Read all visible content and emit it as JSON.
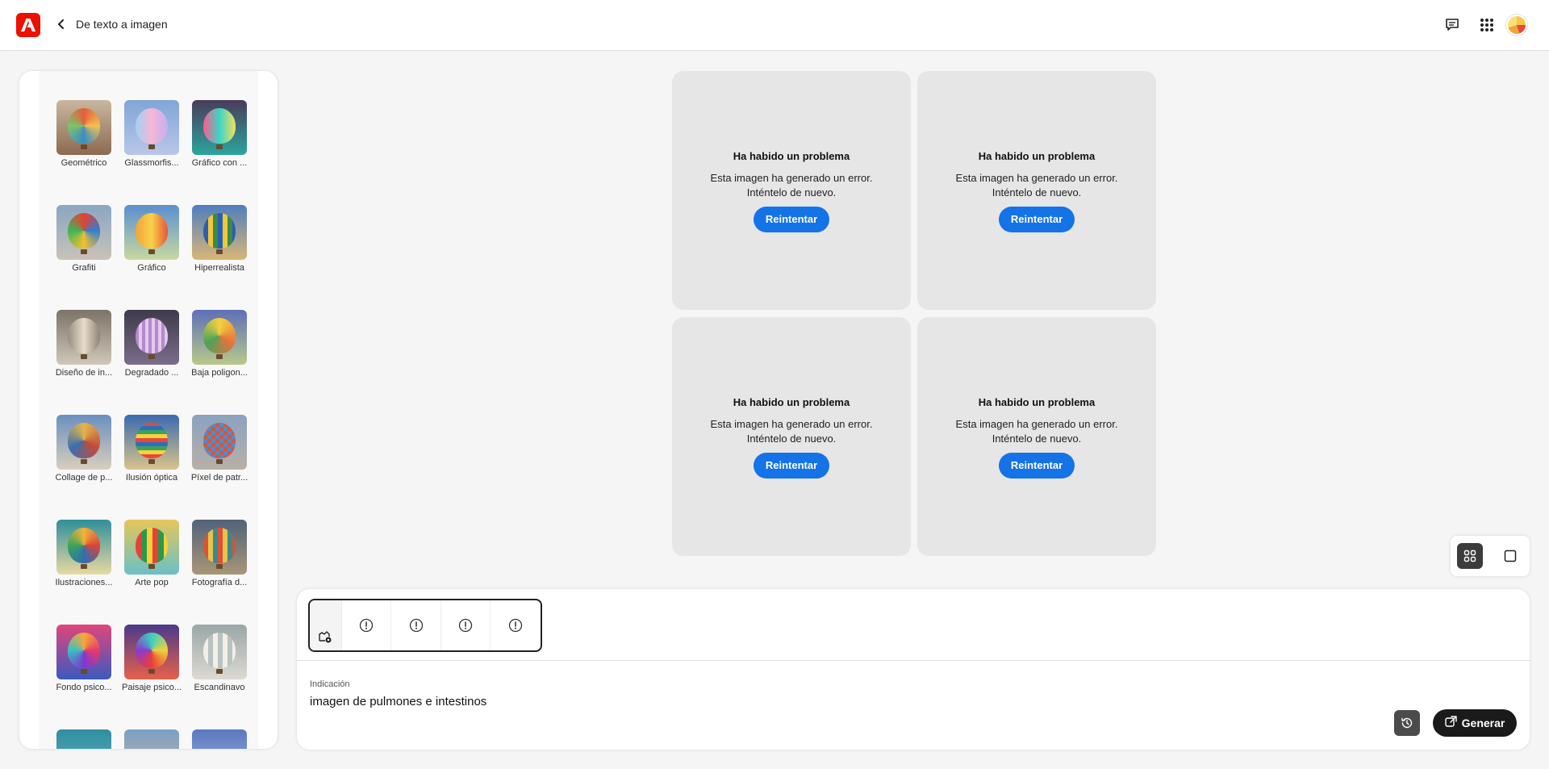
{
  "header": {
    "title": "De texto a imagen",
    "icons": [
      "adobe-logo",
      "chevron-left-icon",
      "comment-icon",
      "apps-grid-icon",
      "avatar"
    ]
  },
  "sidebar": {
    "styles": [
      {
        "label": "Geométrico"
      },
      {
        "label": "Glassmorfis..."
      },
      {
        "label": "Gráfico con ..."
      },
      {
        "label": "Grafiti"
      },
      {
        "label": "Gráfico"
      },
      {
        "label": "Hiperrealista"
      },
      {
        "label": "Diseño de in..."
      },
      {
        "label": "Degradado ..."
      },
      {
        "label": "Baja poligon..."
      },
      {
        "label": "Collage de p..."
      },
      {
        "label": "Ilusión óptica"
      },
      {
        "label": "Píxel de patr..."
      },
      {
        "label": "Ilustraciones..."
      },
      {
        "label": "Arte pop"
      },
      {
        "label": "Fotografía d..."
      },
      {
        "label": "Fondo psico..."
      },
      {
        "label": "Paisaje psico..."
      },
      {
        "label": "Escandinavo"
      },
      {
        "label": ""
      },
      {
        "label": ""
      },
      {
        "label": ""
      }
    ]
  },
  "results": {
    "cards": [
      {
        "title": "Ha habido un problema",
        "line1": "Esta imagen ha generado un error.",
        "line2": "Inténtelo de nuevo.",
        "button": "Reintentar"
      },
      {
        "title": "Ha habido un problema",
        "line1": "Esta imagen ha generado un error.",
        "line2": "Inténtelo de nuevo.",
        "button": "Reintentar"
      },
      {
        "title": "Ha habido un problema",
        "line1": "Esta imagen ha generado un error.",
        "line2": "Inténtelo de nuevo.",
        "button": "Reintentar"
      },
      {
        "title": "Ha habido un problema",
        "line1": "Esta imagen ha generado un error.",
        "line2": "Inténtelo de nuevo.",
        "button": "Reintentar"
      }
    ]
  },
  "view_toggle": {
    "options": [
      "grid-view-icon",
      "single-view-icon"
    ],
    "selected": "grid-view-icon"
  },
  "prompt": {
    "label": "Indicación",
    "value": "imagen de pulmones e intestinos",
    "generate_label": "Generar",
    "thumbnails": [
      "image-settings-icon",
      "alert-icon",
      "alert-icon",
      "alert-icon",
      "alert-icon"
    ]
  },
  "colors": {
    "accent": "#1473e6",
    "brand": "#eb1000",
    "card_bg": "#e6e6e6",
    "dark_button": "#1a1a1a"
  }
}
